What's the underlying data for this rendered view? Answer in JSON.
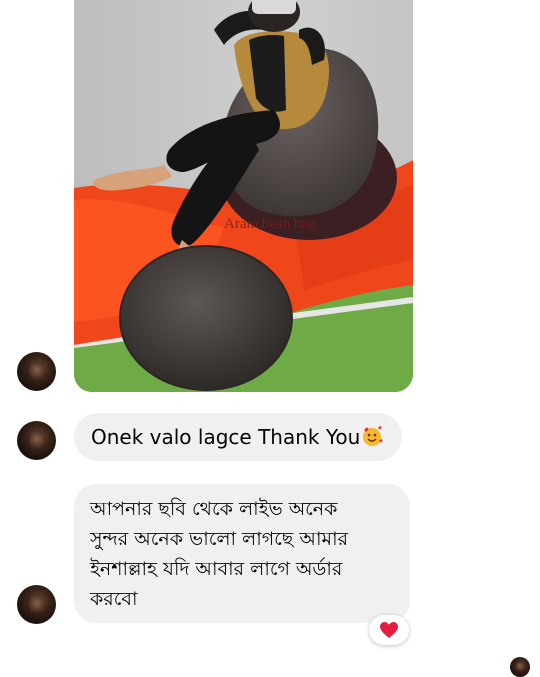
{
  "photo": {
    "watermark": "Aram bean bag"
  },
  "messages": [
    {
      "text": "Onek valo lagce Thank You",
      "emoji": "smiling-face-with-hearts"
    },
    {
      "lines": [
        "আপনার ছবি থেকে লাইভ অনেক",
        "সুন্দর অনেক ভালো লাগছে আমার",
        "ইনশাল্লাহ যদি আবার লাগে অর্ডার",
        "করবো"
      ],
      "reaction": "heart"
    }
  ],
  "colors": {
    "bubble": "#f0f0f0",
    "reaction_heart": "#e41e3f"
  }
}
